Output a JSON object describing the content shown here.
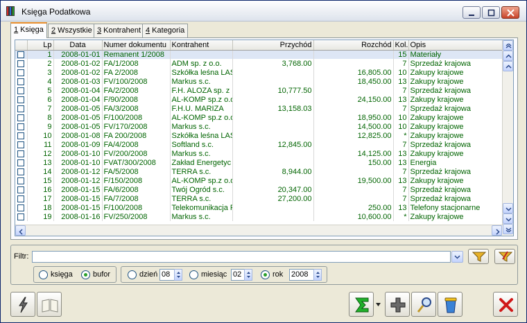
{
  "window": {
    "title": "Księga Podatkowa"
  },
  "tabs": [
    {
      "num": "1",
      "label": " Księga",
      "active": true
    },
    {
      "num": "2",
      "label": " Wszystkie",
      "active": false
    },
    {
      "num": "3",
      "label": " Kontrahent",
      "active": false
    },
    {
      "num": "4",
      "label": " Kategoria",
      "active": false
    }
  ],
  "table": {
    "columns": [
      "",
      "Lp",
      "Data",
      "Numer dokumentu",
      "Kontrahent",
      "Przychód",
      "Rozchód",
      "Kol.",
      "Opis"
    ],
    "rows": [
      {
        "lp": "1",
        "data": "2008-01-01",
        "numer": "Remanent 1/2008",
        "kontrahent": "",
        "przychod": "",
        "rozchod": "",
        "kol": "15",
        "opis": "Materiały"
      },
      {
        "lp": "2",
        "data": "2008-01-02",
        "numer": "FA/1/2008",
        "kontrahent": "ADM sp. z o.o.",
        "przychod": "3,768.00",
        "rozchod": "",
        "kol": "7",
        "opis": "Sprzedaż krajowa"
      },
      {
        "lp": "3",
        "data": "2008-01-02",
        "numer": "FA 2/2008",
        "kontrahent": "Szkółka leśna LAS",
        "przychod": "",
        "rozchod": "16,805.00",
        "kol": "10",
        "opis": "Zakupy krajowe"
      },
      {
        "lp": "4",
        "data": "2008-01-03",
        "numer": "FV/100/2008",
        "kontrahent": "Markus s.c.",
        "przychod": "",
        "rozchod": "18,450.00",
        "kol": "13",
        "opis": "Zakupy krajowe"
      },
      {
        "lp": "5",
        "data": "2008-01-04",
        "numer": "FA/2/2008",
        "kontrahent": "F.H. ALOZA sp. z",
        "przychod": "10,777.50",
        "rozchod": "",
        "kol": "7",
        "opis": "Sprzedaż krajowa"
      },
      {
        "lp": "6",
        "data": "2008-01-04",
        "numer": "F/90/2008",
        "kontrahent": "AL-KOMP sp.z o.o",
        "przychod": "",
        "rozchod": "24,150.00",
        "kol": "13",
        "opis": "Zakupy krajowe"
      },
      {
        "lp": "7",
        "data": "2008-01-05",
        "numer": "FA/3/2008",
        "kontrahent": "F.H.U. MARIZA",
        "przychod": "13,158.03",
        "rozchod": "",
        "kol": "7",
        "opis": "Sprzedaż krajowa"
      },
      {
        "lp": "8",
        "data": "2008-01-05",
        "numer": "F/100/2008",
        "kontrahent": "AL-KOMP sp.z o.o",
        "przychod": "",
        "rozchod": "18,950.00",
        "kol": "10",
        "opis": "Zakupy krajowe"
      },
      {
        "lp": "9",
        "data": "2008-01-05",
        "numer": "FV/170/2008",
        "kontrahent": "Markus s.c.",
        "przychod": "",
        "rozchod": "14,500.00",
        "kol": "10",
        "opis": "Zakupy krajowe"
      },
      {
        "lp": "10",
        "data": "2008-01-08",
        "numer": "FA 200/2008",
        "kontrahent": "Szkółka leśna LAS",
        "przychod": "",
        "rozchod": "12,825.00",
        "kol": "*",
        "opis": "Zakupy krajowe"
      },
      {
        "lp": "11",
        "data": "2008-01-09",
        "numer": "FA/4/2008",
        "kontrahent": "Softland s.c.",
        "przychod": "12,845.00",
        "rozchod": "",
        "kol": "7",
        "opis": "Sprzedaż krajowa"
      },
      {
        "lp": "12",
        "data": "2008-01-10",
        "numer": "FV/200/2008",
        "kontrahent": "Markus s.c.",
        "przychod": "",
        "rozchod": "14,125.00",
        "kol": "13",
        "opis": "Zakupy krajowe"
      },
      {
        "lp": "13",
        "data": "2008-01-10",
        "numer": "FVAT/300/2008",
        "kontrahent": "Zakład Energetyc",
        "przychod": "",
        "rozchod": "150.00",
        "kol": "13",
        "opis": "Energia"
      },
      {
        "lp": "14",
        "data": "2008-01-12",
        "numer": "FA/5/2008",
        "kontrahent": "TERRA s.c.",
        "przychod": "8,944.00",
        "rozchod": "",
        "kol": "7",
        "opis": "Sprzedaż krajowa"
      },
      {
        "lp": "15",
        "data": "2008-01-12",
        "numer": "F/150/2008",
        "kontrahent": "AL-KOMP sp.z o.o",
        "przychod": "",
        "rozchod": "19,500.00",
        "kol": "13",
        "opis": "Zakupy krajowe"
      },
      {
        "lp": "16",
        "data": "2008-01-15",
        "numer": "FA/6/2008",
        "kontrahent": "Twój Ogród s.c.",
        "przychod": "20,347.00",
        "rozchod": "",
        "kol": "7",
        "opis": "Sprzedaż krajowa"
      },
      {
        "lp": "17",
        "data": "2008-01-15",
        "numer": "FA/7/2008",
        "kontrahent": "TERRA s.c.",
        "przychod": "27,200.00",
        "rozchod": "",
        "kol": "7",
        "opis": "Sprzedaż krajowa"
      },
      {
        "lp": "18",
        "data": "2008-01-15",
        "numer": "F/100/2008",
        "kontrahent": "Telekomunikacja F",
        "przychod": "",
        "rozchod": "250.00",
        "kol": "13",
        "opis": "Telefony stacjonarne"
      },
      {
        "lp": "19",
        "data": "2008-01-16",
        "numer": "FV/250/2008",
        "kontrahent": "Markus s.c.",
        "przychod": "",
        "rozchod": "10,600.00",
        "kol": "*",
        "opis": "Zakupy krajowe"
      }
    ]
  },
  "filter": {
    "label": "Filtr:",
    "value": "",
    "scope_options": [
      {
        "label": "księga",
        "selected": false
      },
      {
        "label": "bufor",
        "selected": true
      }
    ],
    "period": {
      "day_label": "dzień",
      "day_value": "08",
      "day_selected": false,
      "month_label": "miesiąc",
      "month_value": "02",
      "month_selected": false,
      "year_label": "rok",
      "year_value": "2008",
      "year_selected": true
    }
  },
  "toolbar": {
    "icons": [
      "lightning-icon",
      "book-icon",
      "sum-icon",
      "plus-icon",
      "magnifier-icon",
      "trash-icon",
      "close-x-icon"
    ]
  },
  "colors": {
    "row_text": "#006400",
    "accent_tab": "#e68b2c",
    "selected_row": "#dde6f5"
  }
}
